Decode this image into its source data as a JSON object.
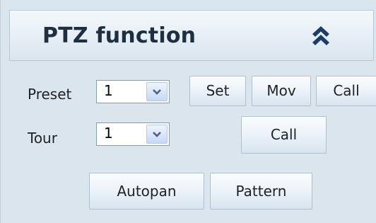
{
  "header": {
    "title": "PTZ function",
    "toggle_icon": "double-chevron-up-icon"
  },
  "preset": {
    "label": "Preset",
    "selected": "1",
    "buttons": {
      "set": "Set",
      "mov": "Mov",
      "call": "Call"
    }
  },
  "tour": {
    "label": "Tour",
    "selected": "1",
    "call_label": "Call"
  },
  "bottom_buttons": {
    "autopan": "Autopan",
    "pattern": "Pattern"
  },
  "colors": {
    "panel_bg": "#dbe5ee",
    "title_text": "#1e2f42",
    "chevron": "#1d3d66",
    "select_arrow": "#4d6185"
  }
}
